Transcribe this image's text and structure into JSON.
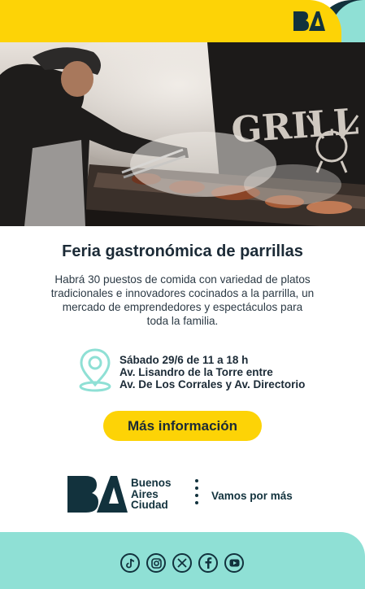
{
  "header": {
    "logo_icon": "ba-logo-icon",
    "colors": {
      "yellow": "#fdd306",
      "teal": "#8fe0d5",
      "navy": "#12323d"
    }
  },
  "hero": {
    "image_description_icon": "grill-photo",
    "sign_text": "GRILL"
  },
  "event": {
    "title": "Feria gastronómica de parrillas",
    "description": "Habrá 30 puestos de comida con variedad de platos tradicionales e innovadores cocinados a la parrilla, un mercado de emprendedores y espectáculos para toda la familia.",
    "location_icon": "map-pin-icon",
    "date_time": "Sábado 29/6 de 11 a 18 h",
    "address_line1": "Av. Lisandro de la Torre entre",
    "address_line2": "Av. De Los Corrales y Av. Directorio"
  },
  "cta": {
    "label": "Más información"
  },
  "brand": {
    "line1": "Buenos",
    "line2": "Aires",
    "line3": "Ciudad",
    "slogan": "Vamos por más"
  },
  "footer": {
    "socials": [
      "tiktok-icon",
      "instagram-icon",
      "x-icon",
      "facebook-icon",
      "youtube-icon"
    ]
  }
}
